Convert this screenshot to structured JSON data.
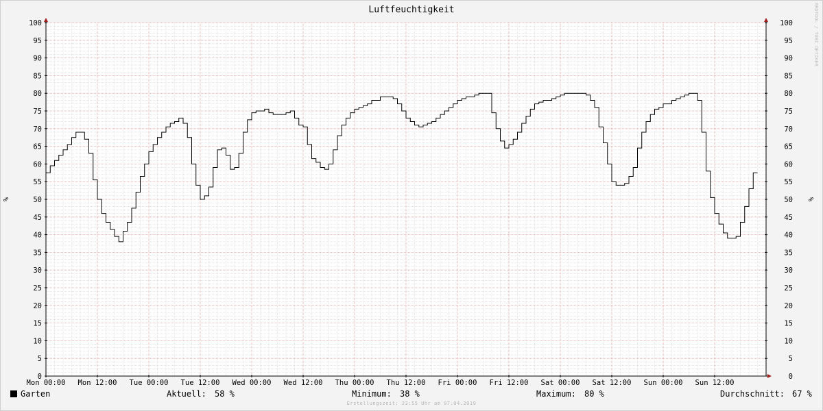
{
  "chart_data": {
    "type": "line",
    "title": "Luftfeuchtigkeit",
    "ylabel": "%",
    "ylim": [
      0,
      100
    ],
    "y_ticks": [
      0,
      5,
      10,
      15,
      20,
      25,
      30,
      35,
      40,
      45,
      50,
      55,
      60,
      65,
      70,
      75,
      80,
      85,
      90,
      95,
      100
    ],
    "x_ticks": [
      "Mon 00:00",
      "Mon 12:00",
      "Tue 00:00",
      "Tue 12:00",
      "Wed 00:00",
      "Wed 12:00",
      "Thu 00:00",
      "Thu 12:00",
      "Fri 00:00",
      "Fri 12:00",
      "Sat 00:00",
      "Sat 12:00",
      "Sun 00:00",
      "Sun 12:00"
    ],
    "x_range_hours": [
      0,
      168
    ],
    "grid": true,
    "watermark": "RRDTOOL / TOBI OETIKER",
    "colors": {
      "line": "#000000",
      "major_grid": "#e8a0a0",
      "minor_grid": "#d4d4d4",
      "axis": "#000000",
      "arrow": "#a02020"
    },
    "series": [
      {
        "name": "Garten",
        "x_hours": [
          0,
          1,
          2,
          3,
          4,
          5,
          6,
          7,
          8,
          9,
          10,
          11,
          12,
          13,
          14,
          15,
          16,
          17,
          18,
          19,
          20,
          21,
          22,
          23,
          24,
          25,
          26,
          27,
          28,
          29,
          30,
          31,
          32,
          33,
          34,
          35,
          36,
          37,
          38,
          39,
          40,
          41,
          42,
          43,
          44,
          45,
          46,
          47,
          48,
          49,
          50,
          51,
          52,
          53,
          54,
          55,
          56,
          57,
          58,
          59,
          60,
          61,
          62,
          63,
          64,
          65,
          66,
          67,
          68,
          69,
          70,
          71,
          72,
          73,
          74,
          75,
          76,
          77,
          78,
          79,
          80,
          81,
          82,
          83,
          84,
          85,
          86,
          87,
          88,
          89,
          90,
          91,
          92,
          93,
          94,
          95,
          96,
          97,
          98,
          99,
          100,
          101,
          102,
          103,
          104,
          105,
          106,
          107,
          108,
          109,
          110,
          111,
          112,
          113,
          114,
          115,
          116,
          117,
          118,
          119,
          120,
          121,
          122,
          123,
          124,
          125,
          126,
          127,
          128,
          129,
          130,
          131,
          132,
          133,
          134,
          135,
          136,
          137,
          138,
          139,
          140,
          141,
          142,
          143,
          144,
          145,
          146,
          147,
          148,
          149,
          150,
          151,
          152,
          153,
          154,
          155,
          156,
          157,
          158,
          159,
          160,
          161,
          162,
          163,
          164,
          165,
          166,
          167
        ],
        "values": [
          57.5,
          59.5,
          61,
          62.5,
          64,
          65.5,
          67.5,
          69,
          69,
          67,
          63,
          55.5,
          50,
          46,
          43.5,
          41.5,
          39.5,
          38,
          41,
          43.5,
          47.5,
          52,
          56.5,
          60,
          63.5,
          65.5,
          67.5,
          69,
          70.5,
          71.5,
          72,
          73,
          71.5,
          67.5,
          60,
          54,
          50,
          51,
          53.5,
          59,
          64,
          64.5,
          62.5,
          58.5,
          59,
          63,
          69,
          72.5,
          74.5,
          75,
          75,
          75.5,
          74.5,
          74,
          74,
          74,
          74.5,
          75,
          73,
          71,
          70.5,
          65.5,
          61.5,
          60.5,
          59,
          58.5,
          60,
          64,
          68,
          71,
          73,
          74.5,
          75.5,
          76,
          76.5,
          77,
          78,
          78,
          79,
          79,
          79,
          78.5,
          77,
          75,
          73,
          72,
          71,
          70.5,
          71,
          71.5,
          72,
          73,
          74,
          75,
          76,
          77,
          78,
          78.5,
          79,
          79,
          79.5,
          80,
          80,
          80,
          74.5,
          70,
          66.5,
          64.5,
          65.5,
          67,
          69,
          71.5,
          73.5,
          75.5,
          77,
          77.5,
          78,
          78,
          78.5,
          79,
          79.5,
          80,
          80,
          80,
          80,
          80,
          79.5,
          78,
          76,
          70.5,
          66,
          60,
          55,
          54,
          54,
          54.5,
          56.5,
          59,
          64.5,
          69,
          72,
          74,
          75.5,
          76,
          77,
          77,
          78,
          78.5,
          79,
          79.5,
          80,
          80,
          78,
          69,
          58,
          50.5,
          46,
          43,
          40.5,
          39,
          39,
          39.5,
          43.5,
          48,
          53,
          57.5
        ]
      }
    ]
  },
  "legend": {
    "series_name": "Garten",
    "aktuell_label": "Aktuell:",
    "aktuell_value": "58 %",
    "minimum_label": "Minimum:",
    "minimum_value": "38 %",
    "maximum_label": "Maximum:",
    "maximum_value": "80 %",
    "durchschnitt_label": "Durchschnitt:",
    "durchschnitt_value": "67 %"
  },
  "footer": {
    "created": "Erstellungszeit: 23:55 Uhr am 07.04.2019"
  }
}
